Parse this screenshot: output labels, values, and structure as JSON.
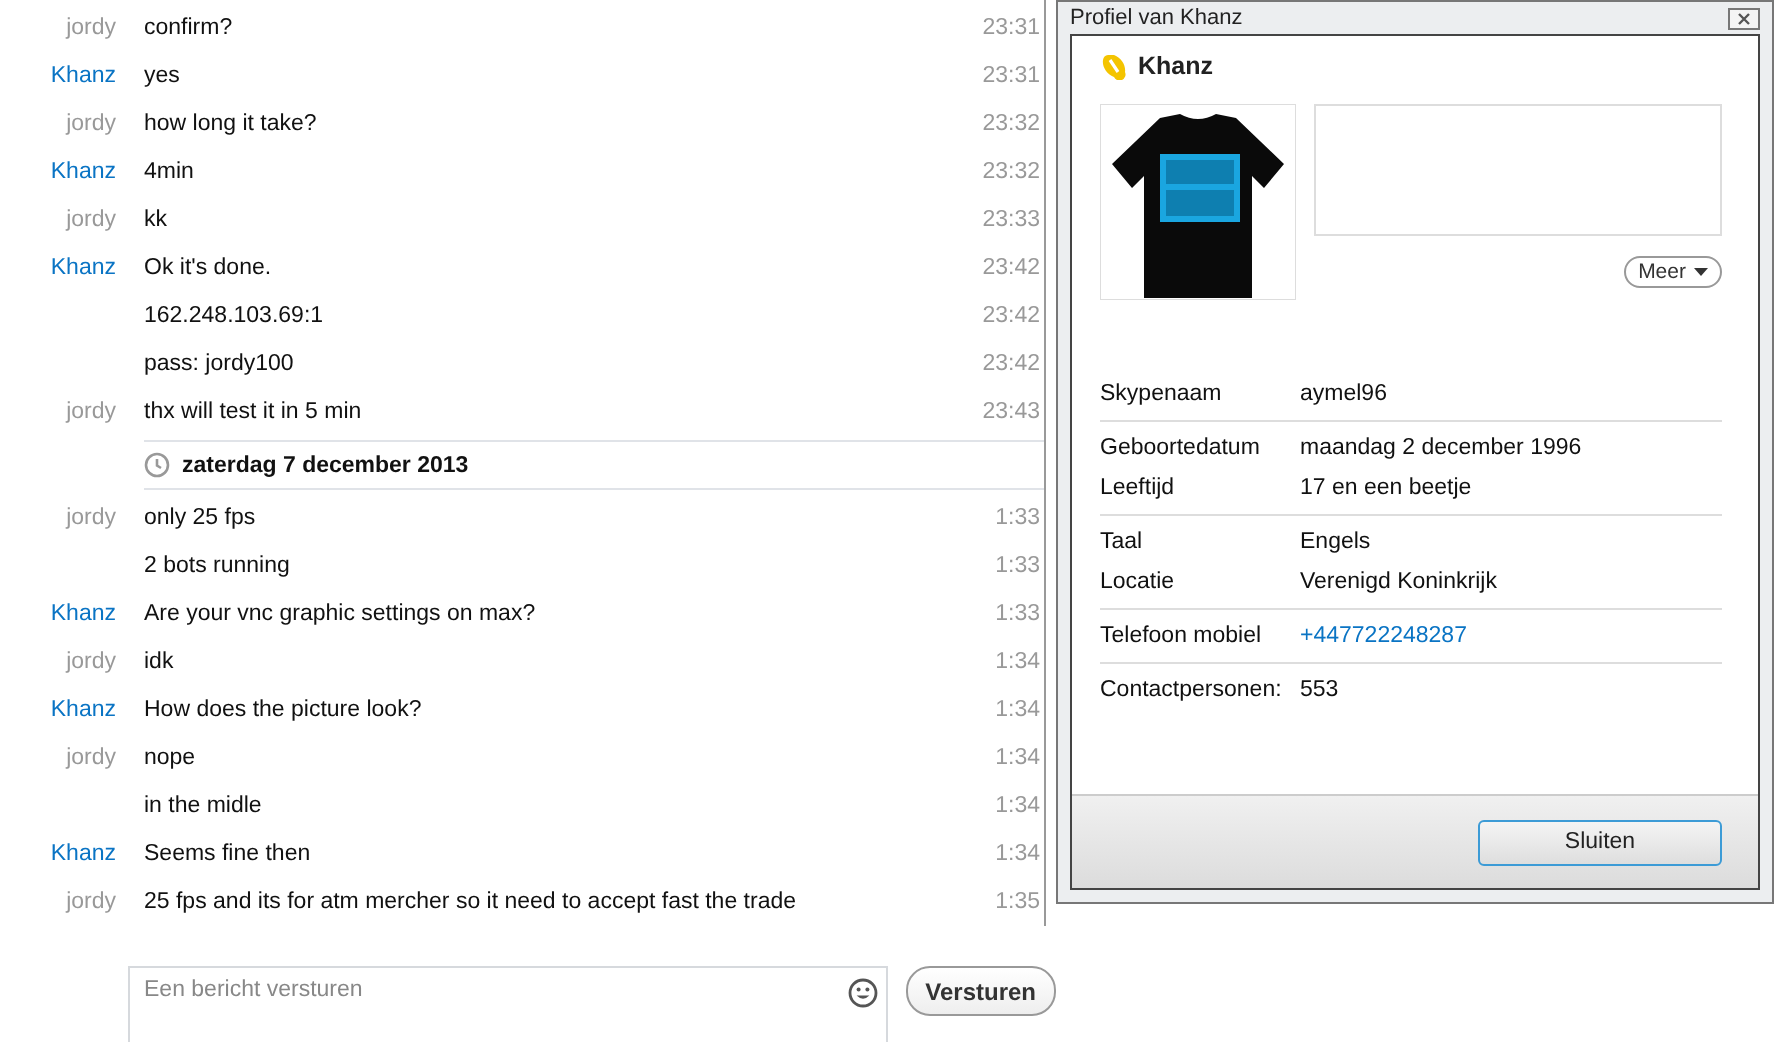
{
  "chat": {
    "entries": [
      {
        "kind": "message",
        "sender": "jordy",
        "color": "#999999",
        "text": "confirm?",
        "time": "23:31"
      },
      {
        "kind": "message",
        "sender": "Khanz",
        "color": "#0a74c4",
        "text": "yes",
        "time": "23:31"
      },
      {
        "kind": "message",
        "sender": "jordy",
        "color": "#999999",
        "text": "how long it take?",
        "time": "23:32"
      },
      {
        "kind": "message",
        "sender": "Khanz",
        "color": "#0a74c4",
        "text": "4min",
        "time": "23:32"
      },
      {
        "kind": "message",
        "sender": "jordy",
        "color": "#999999",
        "text": "kk",
        "time": "23:33"
      },
      {
        "kind": "message",
        "sender": "Khanz",
        "color": "#0a74c4",
        "text": "Ok it's done.",
        "time": "23:42"
      },
      {
        "kind": "message",
        "text": "162.248.103.69:1",
        "time": "23:42"
      },
      {
        "kind": "message",
        "text": "pass: jordy100",
        "time": "23:42"
      },
      {
        "kind": "message",
        "sender": "jordy",
        "color": "#999999",
        "text": "thx will test it in 5 min",
        "time": "23:43"
      },
      {
        "kind": "date",
        "text": "zaterdag 7 december 2013"
      },
      {
        "kind": "message",
        "sender": "jordy",
        "color": "#999999",
        "text": "only 25 fps",
        "time": "1:33"
      },
      {
        "kind": "message",
        "text": "2 bots running",
        "time": "1:33"
      },
      {
        "kind": "message",
        "sender": "Khanz",
        "color": "#0a74c4",
        "text": "Are your vnc graphic settings on max?",
        "time": "1:33"
      },
      {
        "kind": "message",
        "sender": "jordy",
        "color": "#999999",
        "text": "idk",
        "time": "1:34"
      },
      {
        "kind": "message",
        "sender": "Khanz",
        "color": "#0a74c4",
        "text": "How does the picture look?",
        "time": "1:34"
      },
      {
        "kind": "message",
        "sender": "jordy",
        "color": "#999999",
        "text": "nope",
        "time": "1:34"
      },
      {
        "kind": "message",
        "text": "in the midle",
        "time": "1:34"
      },
      {
        "kind": "message",
        "sender": "Khanz",
        "color": "#0a74c4",
        "text": "Seems fine then",
        "time": "1:34"
      },
      {
        "kind": "message",
        "sender": "jordy",
        "color": "#999999",
        "text": "25 fps and its for atm mercher so it need to accept fast the trade",
        "time": "1:35"
      }
    ],
    "composer": {
      "placeholder": "Een bericht versturen"
    },
    "send_button": "Versturen"
  },
  "profile_dialog": {
    "title": "Profiel van Khanz",
    "name": "Khanz",
    "more_button": "Meer",
    "groups": [
      [
        {
          "label": "Skypenaam",
          "value": "aymel96"
        }
      ],
      [
        {
          "label": "Geboortedatum",
          "value": "maandag 2 december 1996"
        },
        {
          "label": "Leeftijd",
          "value": "17 en een beetje"
        }
      ],
      [
        {
          "label": "Taal",
          "value": "Engels"
        },
        {
          "label": "Locatie",
          "value": "Verenigd Koninkrijk"
        }
      ],
      [
        {
          "label": "Telefoon mobiel",
          "value": "+447722248287",
          "kind": "link"
        }
      ],
      [
        {
          "label": "Contactpersonen:",
          "value": "553"
        }
      ]
    ],
    "close_button": "Sluiten"
  }
}
